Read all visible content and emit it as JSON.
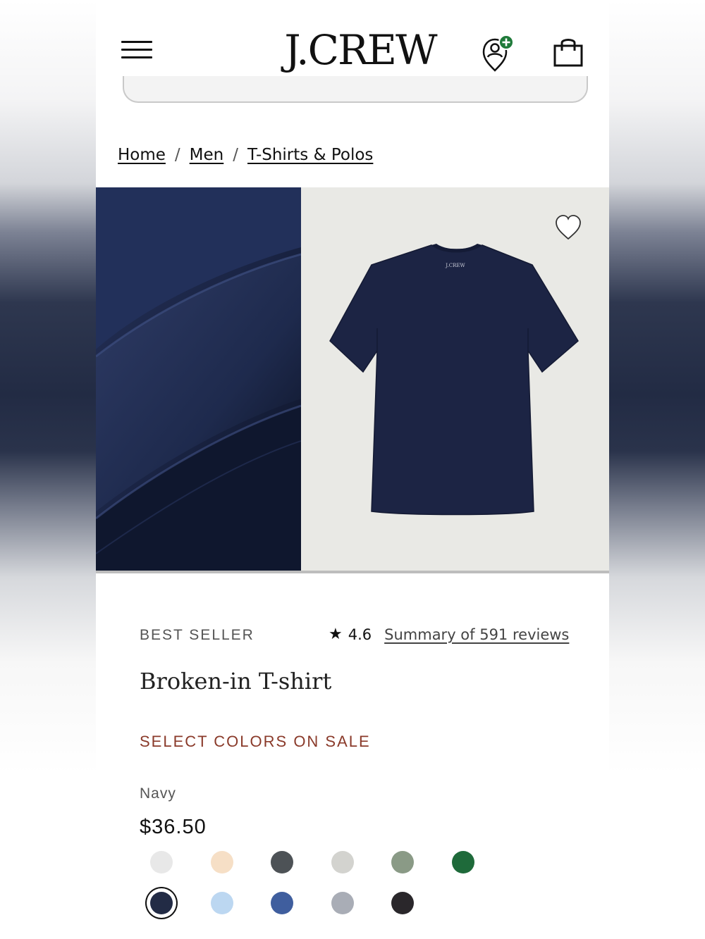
{
  "header": {
    "logo": "J.CREW",
    "menu_icon": "hamburger-menu-icon",
    "account_icon": "account-add-icon",
    "bag_icon": "shopping-bag-icon",
    "accent_color": "#1f7a3a"
  },
  "breadcrumb": {
    "items": [
      "Home",
      "Men",
      "T-Shirts & Polos"
    ],
    "separator": "/"
  },
  "gallery": {
    "wishlist_icon": "heart-outline-icon",
    "shirt_label": "J.CREW"
  },
  "product": {
    "badge": "BEST SELLER",
    "rating": "4.6",
    "reviews_link": "Summary of 591 reviews",
    "name": "Broken-in T-shirt",
    "sale_text": "SELECT COLORS ON SALE",
    "selected_color": "Navy",
    "price": "$36.50",
    "swatches": [
      {
        "color": "#e8e8e8",
        "selected": false
      },
      {
        "color": "#f6dfc6",
        "selected": false
      },
      {
        "color": "#4d5256",
        "selected": false
      },
      {
        "color": "#d3d3cf",
        "selected": false
      },
      {
        "color": "#8a9a86",
        "selected": false
      },
      {
        "color": "#1e6a3a",
        "selected": false
      },
      {
        "color": "#222b45",
        "selected": true
      },
      {
        "color": "#bcd7f1",
        "selected": false
      },
      {
        "color": "#3f5e9e",
        "selected": false
      },
      {
        "color": "#a9adb6",
        "selected": false
      },
      {
        "color": "#2a272b",
        "selected": false
      }
    ]
  }
}
